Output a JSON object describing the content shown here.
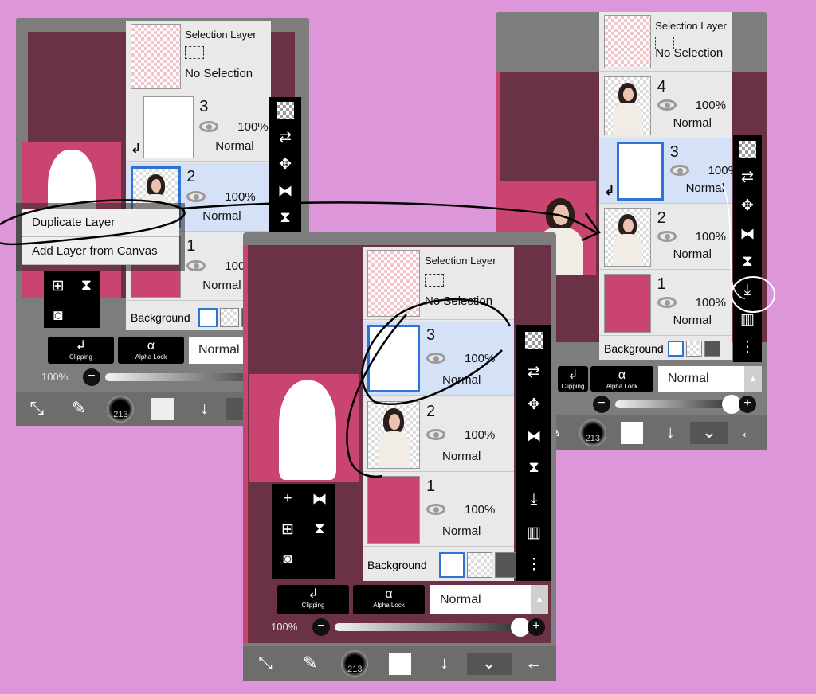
{
  "background_color": "#dd96d9",
  "accent_color": "#2d74d6",
  "panels": {
    "a": {
      "selection_layer": {
        "title": "Selection Layer",
        "status": "No Selection"
      },
      "layers": [
        {
          "name": "3",
          "opacity": "100%",
          "blend": "Normal",
          "thumb": "white",
          "selected": false,
          "clipped": true
        },
        {
          "name": "2",
          "opacity": "100%",
          "blend": "Normal",
          "thumb": "photo",
          "selected": true,
          "clipped": false
        },
        {
          "name": "1",
          "opacity": "100%",
          "blend": "Normal",
          "thumb": "pink",
          "selected": false,
          "clipped": false
        }
      ],
      "background_label": "Background",
      "context_menu": [
        "Duplicate Layer",
        "Add Layer from Canvas"
      ],
      "clipping_label": "Clipping",
      "alpha_lock_label": "Alpha Lock",
      "blend_mode": "Normal",
      "opacity_label": "100%",
      "brush_size": "213"
    },
    "b": {
      "selection_layer": {
        "title": "Selection Layer",
        "status": "No Selection"
      },
      "layers": [
        {
          "name": "3",
          "opacity": "100%",
          "blend": "Normal",
          "thumb": "white",
          "selected": true,
          "clipped": false
        },
        {
          "name": "2",
          "opacity": "100%",
          "blend": "Normal",
          "thumb": "photo",
          "selected": false,
          "clipped": false
        },
        {
          "name": "1",
          "opacity": "100%",
          "blend": "Normal",
          "thumb": "pink",
          "selected": false,
          "clipped": false
        }
      ],
      "background_label": "Background",
      "clipping_label": "Clipping",
      "alpha_lock_label": "Alpha Lock",
      "blend_mode": "Normal",
      "opacity_label": "100%",
      "opacity_value": 1.0,
      "brush_size": "213"
    },
    "c": {
      "selection_layer": {
        "title": "Selection Layer",
        "status": "No Selection"
      },
      "layers": [
        {
          "name": "4",
          "opacity": "100%",
          "blend": "Normal",
          "thumb": "photo",
          "selected": false,
          "clipped": false
        },
        {
          "name": "3",
          "opacity": "100%",
          "blend": "Normal",
          "thumb": "white",
          "selected": true,
          "clipped": true
        },
        {
          "name": "2",
          "opacity": "100%",
          "blend": "Normal",
          "thumb": "photo",
          "selected": false,
          "clipped": false
        },
        {
          "name": "1",
          "opacity": "100%",
          "blend": "Normal",
          "thumb": "pink",
          "selected": false,
          "clipped": false
        }
      ],
      "background_label": "Background",
      "clipping_label": "Clipping",
      "alpha_lock_label": "Alpha Lock",
      "blend_mode": "Normal",
      "opacity_value": 1.0,
      "brush_size": "213"
    }
  },
  "toolbar_icons": [
    "transparent-fill-icon",
    "transfer-icon",
    "move-icon",
    "flip-horizontal-icon",
    "flip-vertical-icon",
    "merge-down-icon",
    "trash-icon",
    "more-icon"
  ],
  "annotation_color": "#000000",
  "highlight_circle_color": "#ffffff"
}
